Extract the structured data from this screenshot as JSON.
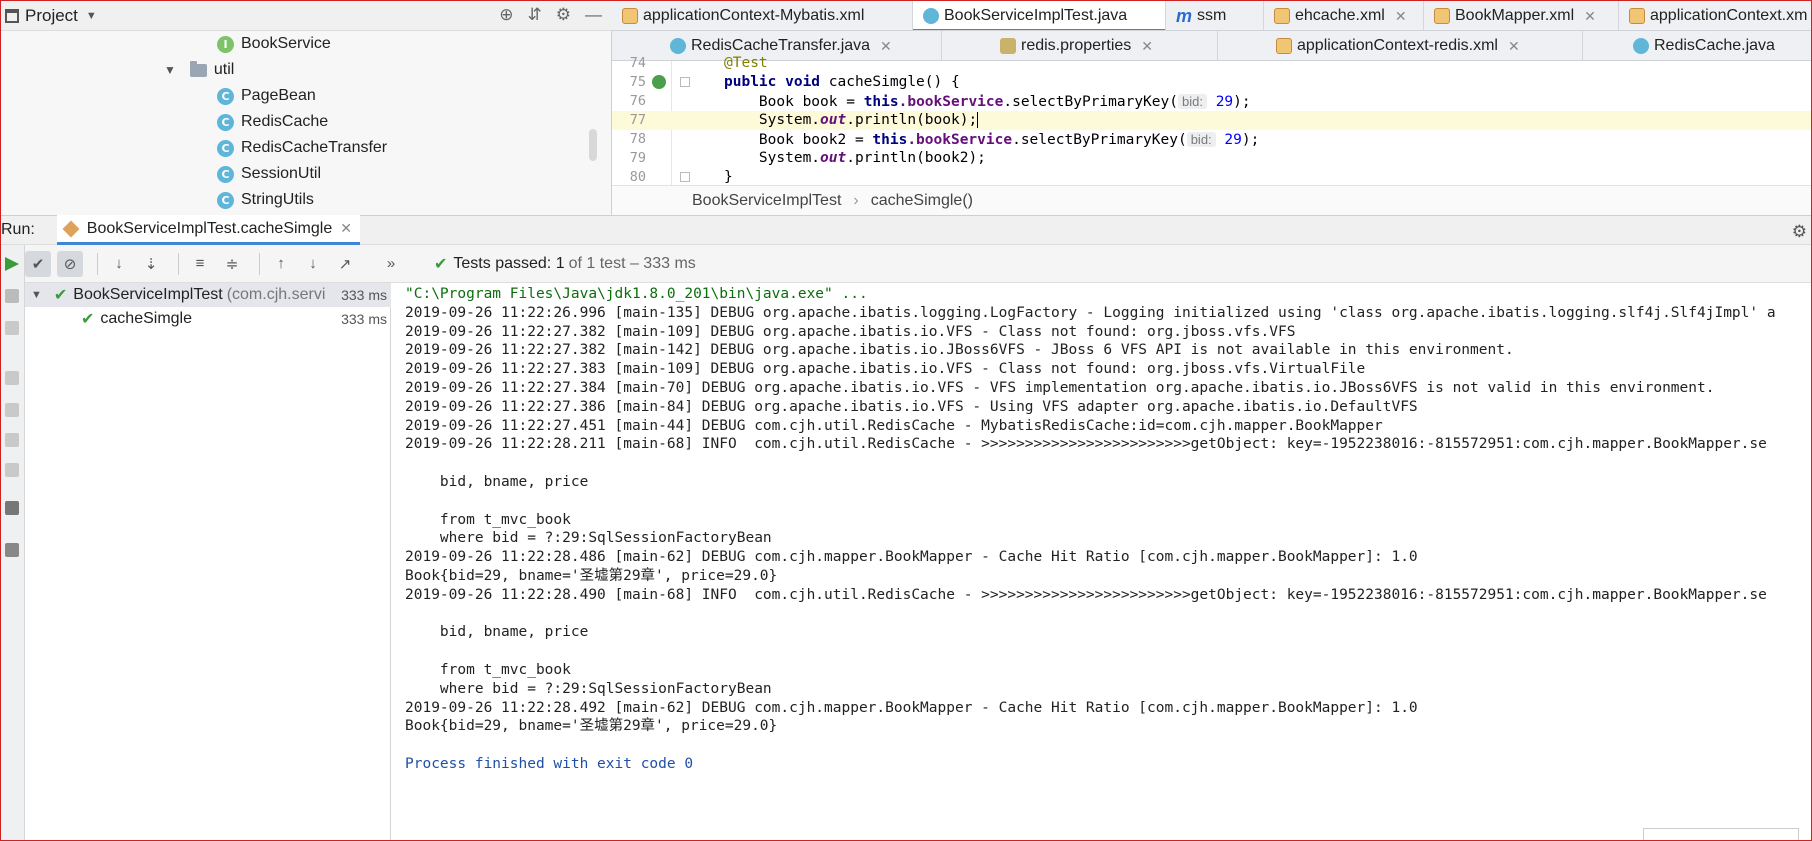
{
  "project": {
    "title": "Project",
    "tree": [
      {
        "label": "BookService",
        "icon": "interface-icon"
      },
      {
        "label": "util",
        "icon": "folder-icon"
      },
      {
        "label": "PageBean",
        "icon": "class-icon"
      },
      {
        "label": "RedisCache",
        "icon": "class-icon"
      },
      {
        "label": "RedisCacheTransfer",
        "icon": "class-icon"
      },
      {
        "label": "SessionUtil",
        "icon": "class-icon"
      },
      {
        "label": "StringUtils",
        "icon": "class-icon"
      }
    ]
  },
  "editor": {
    "tabs_row1": [
      {
        "label": "applicationContext-Mybatis.xml"
      },
      {
        "label": "BookServiceImplTest.java"
      },
      {
        "label": "ssm"
      },
      {
        "label": "ehcache.xml"
      },
      {
        "label": "BookMapper.xml"
      },
      {
        "label": "applicationContext.xm"
      }
    ],
    "tabs_row2": [
      {
        "label": "RedisCacheTransfer.java"
      },
      {
        "label": "redis.properties"
      },
      {
        "label": "applicationContext-redis.xml"
      },
      {
        "label": "RedisCache.java"
      }
    ],
    "line_numbers": [
      "74",
      "75",
      "76",
      "77",
      "78",
      "79",
      "80"
    ],
    "code": {
      "l74": "@Test",
      "l75_kw": "public void",
      "l75_rest": " cacheSimgle() {",
      "l76_a": "    Book book = ",
      "l76_this": "this",
      "l76_field": ".bookService",
      "l76_call": ".selectByPrimaryKey(",
      "hint": "bid:",
      "arg": "29",
      "l76_end": ");",
      "l77_a": "    System.",
      "out": "out",
      "l77_b": ".println(book);",
      "l78_a": "    Book book2 = ",
      "l79_b": ".println(book2);",
      "l80": "}"
    },
    "breadcrumbs": [
      "BookServiceImplTest",
      "cacheSimgle()"
    ]
  },
  "run": {
    "label": "Run:",
    "tab": "BookServiceImplTest.cacheSimgle",
    "status_prefix": "Tests passed:",
    "status_count": "1",
    "status_rest": "of 1 test – 333 ms",
    "tests": [
      {
        "name": "BookServiceImplTest",
        "pkg": "(com.cjh.servi",
        "time": "333 ms"
      },
      {
        "name": "cacheSimgle",
        "pkg": "",
        "time": "333 ms"
      }
    ],
    "console": [
      "\"C:\\Program Files\\Java\\jdk1.8.0_201\\bin\\java.exe\" ...",
      "2019-09-26 11:22:26.996 [main-135] DEBUG org.apache.ibatis.logging.LogFactory - Logging initialized using 'class org.apache.ibatis.logging.slf4j.Slf4jImpl' a",
      "2019-09-26 11:22:27.382 [main-109] DEBUG org.apache.ibatis.io.VFS - Class not found: org.jboss.vfs.VFS",
      "2019-09-26 11:22:27.382 [main-142] DEBUG org.apache.ibatis.io.JBoss6VFS - JBoss 6 VFS API is not available in this environment.",
      "2019-09-26 11:22:27.383 [main-109] DEBUG org.apache.ibatis.io.VFS - Class not found: org.jboss.vfs.VirtualFile",
      "2019-09-26 11:22:27.384 [main-70] DEBUG org.apache.ibatis.io.VFS - VFS implementation org.apache.ibatis.io.JBoss6VFS is not valid in this environment.",
      "2019-09-26 11:22:27.386 [main-84] DEBUG org.apache.ibatis.io.VFS - Using VFS adapter org.apache.ibatis.io.DefaultVFS",
      "2019-09-26 11:22:27.451 [main-44] DEBUG com.cjh.util.RedisCache - MybatisRedisCache:id=com.cjh.mapper.BookMapper",
      "2019-09-26 11:22:28.211 [main-68] INFO  com.cjh.util.RedisCache - >>>>>>>>>>>>>>>>>>>>>>>>getObject: key=-1952238016:-815572951:com.cjh.mapper.BookMapper.se",
      "",
      "    bid, bname, price",
      "",
      "    from t_mvc_book",
      "    where bid = ?:29:SqlSessionFactoryBean",
      "2019-09-26 11:22:28.486 [main-62] DEBUG com.cjh.mapper.BookMapper - Cache Hit Ratio [com.cjh.mapper.BookMapper]: 1.0",
      "Book{bid=29, bname='圣墟第29章', price=29.0}",
      "2019-09-26 11:22:28.490 [main-68] INFO  com.cjh.util.RedisCache - >>>>>>>>>>>>>>>>>>>>>>>>getObject: key=-1952238016:-815572951:com.cjh.mapper.BookMapper.se",
      "",
      "    bid, bname, price",
      "",
      "    from t_mvc_book",
      "    where bid = ?:29:SqlSessionFactoryBean",
      "2019-09-26 11:22:28.492 [main-62] DEBUG com.cjh.mapper.BookMapper - Cache Hit Ratio [com.cjh.mapper.BookMapper]: 1.0",
      "Book{bid=29, bname='圣墟第29章', price=29.0}",
      "",
      "Process finished with exit code 0"
    ]
  },
  "colors": {
    "accent": "#3d86d9",
    "pass": "#3b9b3b",
    "current_line": "#fcfad8"
  }
}
